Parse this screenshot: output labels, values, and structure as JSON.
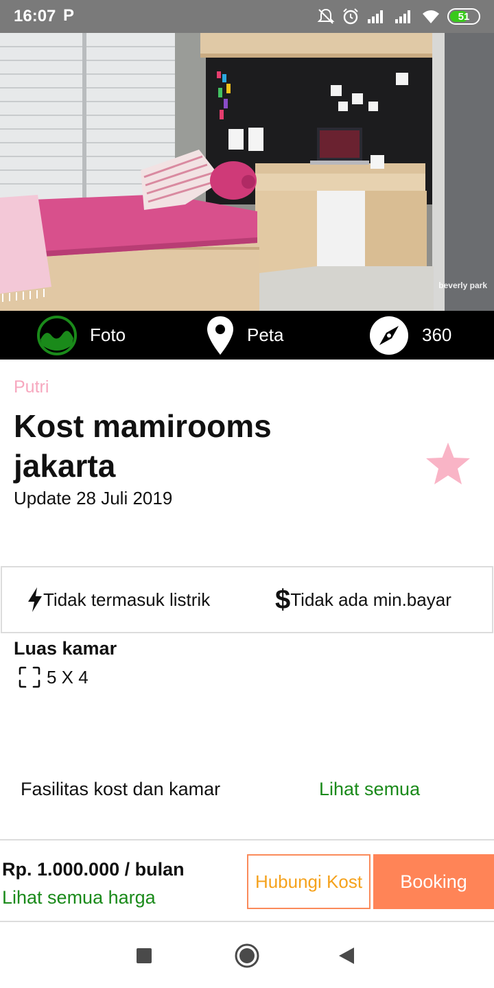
{
  "status_bar": {
    "time": "16:07",
    "carrier_icon": "p-icon",
    "battery": "51",
    "icons": [
      "mute-icon",
      "alarm-icon",
      "signal-icon",
      "signal-icon",
      "wifi-icon",
      "battery-icon"
    ]
  },
  "hero": {
    "watermark": "beverly park"
  },
  "media_tabs": [
    {
      "label": "Foto",
      "icon": "photo-icon",
      "accent": "#1a8a1a"
    },
    {
      "label": "Peta",
      "icon": "map-pin-icon"
    },
    {
      "label": "360",
      "icon": "compass-icon"
    }
  ],
  "listing": {
    "gender": "Putri",
    "title": "Kost mamirooms jakarta",
    "update": "Update 28 Juli 2019",
    "favorite_color": "#f9b4c6"
  },
  "info": {
    "electricity": "Tidak termasuk listrik",
    "min_payment": "Tidak ada min.bayar"
  },
  "room": {
    "label": "Luas kamar",
    "size": "5 X 4"
  },
  "facilities": {
    "label": "Fasilitas kost dan kamar",
    "see_all": "Lihat semua"
  },
  "pricing": {
    "price": "Rp. 1.000.000 / bulan",
    "see_all_prices": "Lihat semua harga",
    "contact_button": "Hubungi Kost",
    "booking_button": "Booking",
    "accent": "#ff8457"
  },
  "nav": [
    "recents-icon",
    "home-icon",
    "back-icon"
  ]
}
